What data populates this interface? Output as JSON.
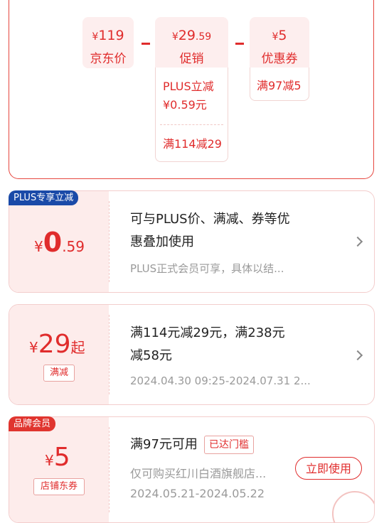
{
  "summary": {
    "jd": {
      "symbol": "¥",
      "int": "119",
      "dec": "",
      "label": "京东价"
    },
    "promo": {
      "symbol": "¥",
      "int": "29",
      "dec": ".59",
      "label": "促销"
    },
    "coupon": {
      "symbol": "¥",
      "int": "5",
      "dec": "",
      "label": "优惠券"
    },
    "promo_details": [
      "PLUS立减",
      "¥0.59元",
      "满114减29"
    ],
    "coupon_details": [
      "满97减5"
    ]
  },
  "plus_card": {
    "tag": "PLUS专享立减",
    "symbol": "¥",
    "int": "0",
    "dec": ".59",
    "title_line1": "可与PLUS价、满减、券等优",
    "title_line2": "惠叠加使用",
    "sub": "PLUS正式会员可享，具体以结..."
  },
  "full_card": {
    "symbol": "¥",
    "int": "29",
    "suffix": "起",
    "badge": "满减",
    "title_line1": "满114元减29元，满238元",
    "title_line2": "减58元",
    "sub": "2024.04.30 09:25-2024.07.31 2..."
  },
  "coupon_card": {
    "tag": "品牌会员",
    "symbol": "¥",
    "int": "5",
    "badge": "店铺东券",
    "title": "满97元可用",
    "status": "已达门槛",
    "sub": "仅可购买红川白酒旗舰店...",
    "date": "2024.05.21-2024.05.22",
    "button": "立即使用"
  },
  "colors": {
    "accent": "#e02c2c",
    "plus_tag": "#1a4aa8"
  }
}
